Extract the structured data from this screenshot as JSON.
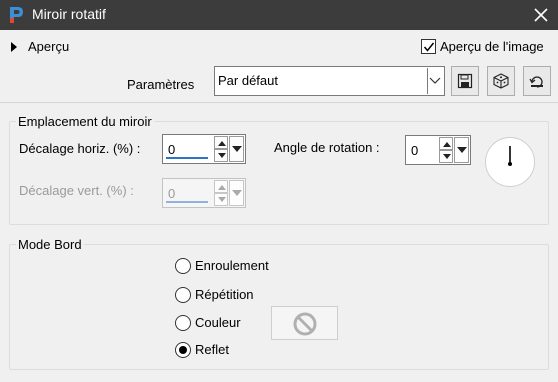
{
  "window": {
    "title": "Miroir rotatif"
  },
  "preview": {
    "label": "Aperçu",
    "image_preview_label": "Aperçu de l'image",
    "image_preview_checked": true
  },
  "presets": {
    "label": "Paramètres",
    "selected": "Par défaut"
  },
  "mirror_location": {
    "title": "Emplacement du miroir",
    "horizontal_offset": {
      "label": "Décalage horiz. (%) :",
      "value": "0",
      "enabled": true
    },
    "vertical_offset": {
      "label": "Décalage vert. (%) :",
      "value": "0",
      "enabled": false
    },
    "rotation_angle": {
      "label": "Angle de rotation :",
      "value": "0"
    }
  },
  "edge_mode": {
    "title": "Mode Bord",
    "options": [
      {
        "label": "Enroulement",
        "selected": false
      },
      {
        "label": "Répétition",
        "selected": false
      },
      {
        "label": "Couleur",
        "selected": false
      },
      {
        "label": "Reflet",
        "selected": true
      }
    ]
  },
  "icons": {
    "app": "app-logo-icon",
    "close": "close-icon",
    "save": "save-icon",
    "randomize": "dice-icon",
    "reset": "reset-icon",
    "no_color": "no-color-icon"
  },
  "colors": {
    "titlebar": "#3c3c3c",
    "accent": "#2e73c5"
  }
}
